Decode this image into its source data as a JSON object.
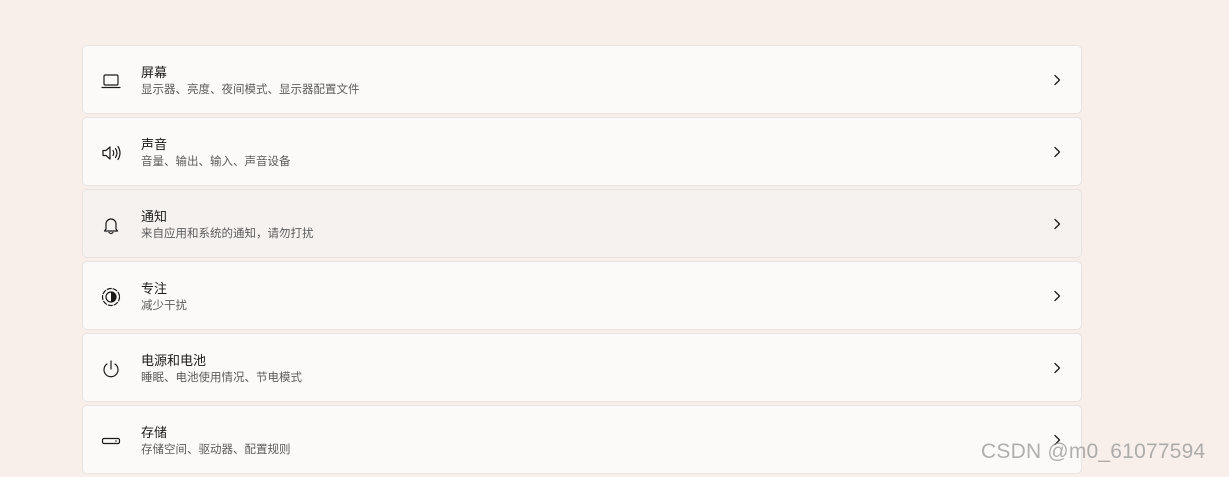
{
  "settings": {
    "items": [
      {
        "icon": "laptop-icon",
        "title": "屏幕",
        "description": "显示器、亮度、夜间模式、显示器配置文件"
      },
      {
        "icon": "speaker-icon",
        "title": "声音",
        "description": "音量、输出、输入、声音设备"
      },
      {
        "icon": "bell-icon",
        "title": "通知",
        "description": "来自应用和系统的通知，请勿打扰"
      },
      {
        "icon": "focus-icon",
        "title": "专注",
        "description": "减少干扰"
      },
      {
        "icon": "power-icon",
        "title": "电源和电池",
        "description": "睡眠、电池使用情况、节电模式"
      },
      {
        "icon": "storage-icon",
        "title": "存储",
        "description": "存储空间、驱动器、配置规则"
      }
    ],
    "chevron_icon": "chevron-right-icon"
  },
  "watermark": {
    "text": "CSDN @m0_61077594"
  },
  "colors": {
    "background": "#f8efeb",
    "card": "#fcfaf9",
    "card_hover": "#f6f2f0",
    "title": "#1a1a1a",
    "description": "#5c5c5c"
  }
}
